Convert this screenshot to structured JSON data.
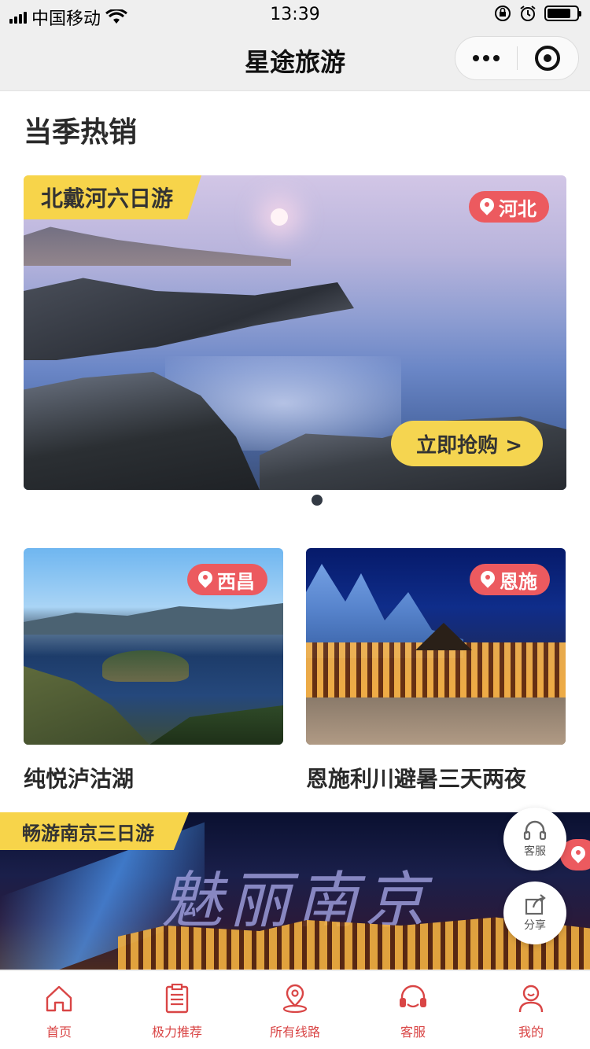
{
  "status_bar": {
    "carrier": "中国移动",
    "time": "13:39"
  },
  "nav": {
    "title": "星途旅游"
  },
  "section": {
    "title": "当季热销"
  },
  "hero": {
    "tag": "北戴河六日游",
    "location": "河北",
    "cta": "立即抢购 >"
  },
  "cards": [
    {
      "location": "西昌",
      "title": "纯悦泸沽湖"
    },
    {
      "location": "恩施",
      "title": "恩施利川避暑三天两夜"
    }
  ],
  "banner2": {
    "tag": "畅游南京三日游",
    "calligraphy": "魅丽南京"
  },
  "float_buttons": {
    "service": "客服",
    "share": "分享"
  },
  "tabbar": [
    {
      "label": "首页",
      "icon": "home-icon"
    },
    {
      "label": "极力推荐",
      "icon": "clipboard-icon"
    },
    {
      "label": "所有线路",
      "icon": "location-pin-icon"
    },
    {
      "label": "客服",
      "icon": "headset-icon"
    },
    {
      "label": "我的",
      "icon": "user-icon"
    }
  ],
  "colors": {
    "accent_red": "#d94545",
    "pill_red": "#ec5a5f",
    "tag_yellow": "#f7d44a"
  }
}
